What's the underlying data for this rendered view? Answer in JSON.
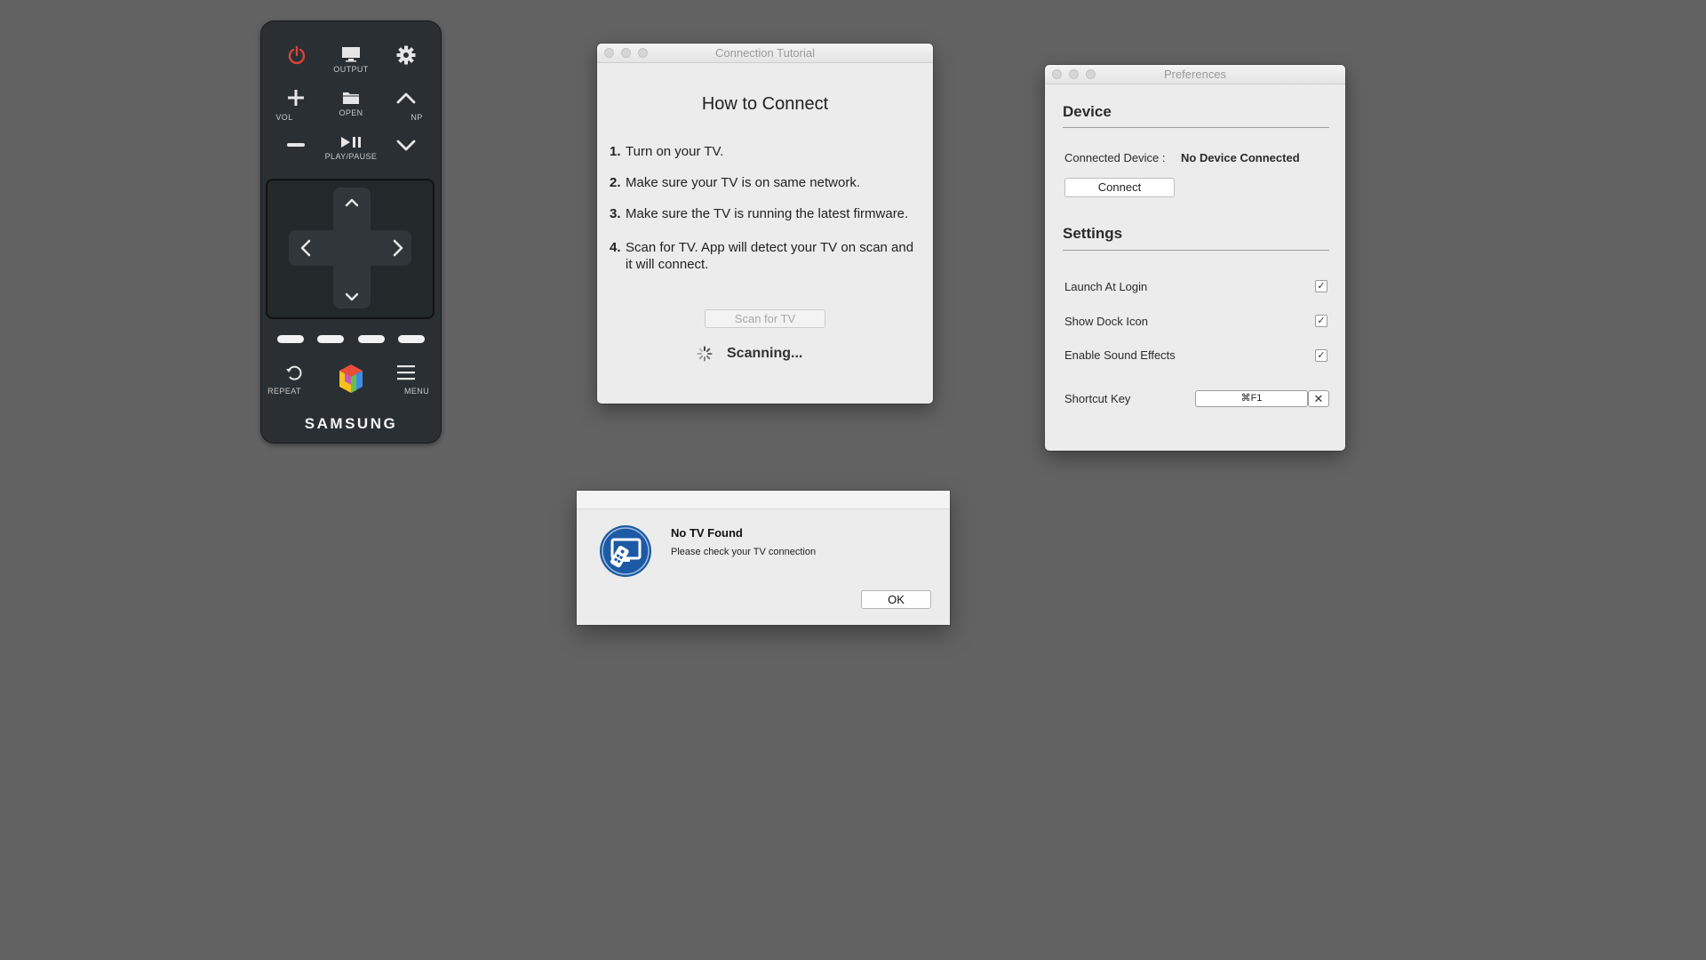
{
  "remote": {
    "output_label": "OUTPUT",
    "vol_label": "VOL",
    "open_label": "OPEN",
    "np_label": "NP",
    "playpause_label": "PLAY/PAUSE",
    "repeat_label": "REPEAT",
    "menu_label": "MENU",
    "brand": "SAMSUNG",
    "power_color": "#d9443b"
  },
  "tutorial": {
    "window_title": "Connection Tutorial",
    "heading": "How to Connect",
    "steps": [
      {
        "num": "1.",
        "text": "Turn on your TV."
      },
      {
        "num": "2.",
        "text": "Make sure your TV is on same network."
      },
      {
        "num": "3.",
        "text": "Make sure the TV is running the latest firmware."
      },
      {
        "num": "4.",
        "text": "Scan for TV. App will detect your TV on scan and it will connect."
      }
    ],
    "scan_button": "Scan for TV",
    "scanning_text": "Scanning..."
  },
  "preferences": {
    "window_title": "Preferences",
    "device_heading": "Device",
    "connected_label": "Connected Device :",
    "connected_value": "No Device Connected",
    "connect_button": "Connect",
    "settings_heading": "Settings",
    "options": [
      {
        "label": "Launch At Login",
        "checked": true
      },
      {
        "label": "Show Dock Icon",
        "checked": true
      },
      {
        "label": "Enable Sound Effects",
        "checked": true
      }
    ],
    "check_glyph": "✓",
    "shortcut_label": "Shortcut Key",
    "shortcut_value": "⌘F1",
    "shortcut_clear": "✕"
  },
  "alert": {
    "title": "No TV Found",
    "message": "Please check your TV connection",
    "ok_button": "OK",
    "icon_color": "#1c5aa6"
  }
}
